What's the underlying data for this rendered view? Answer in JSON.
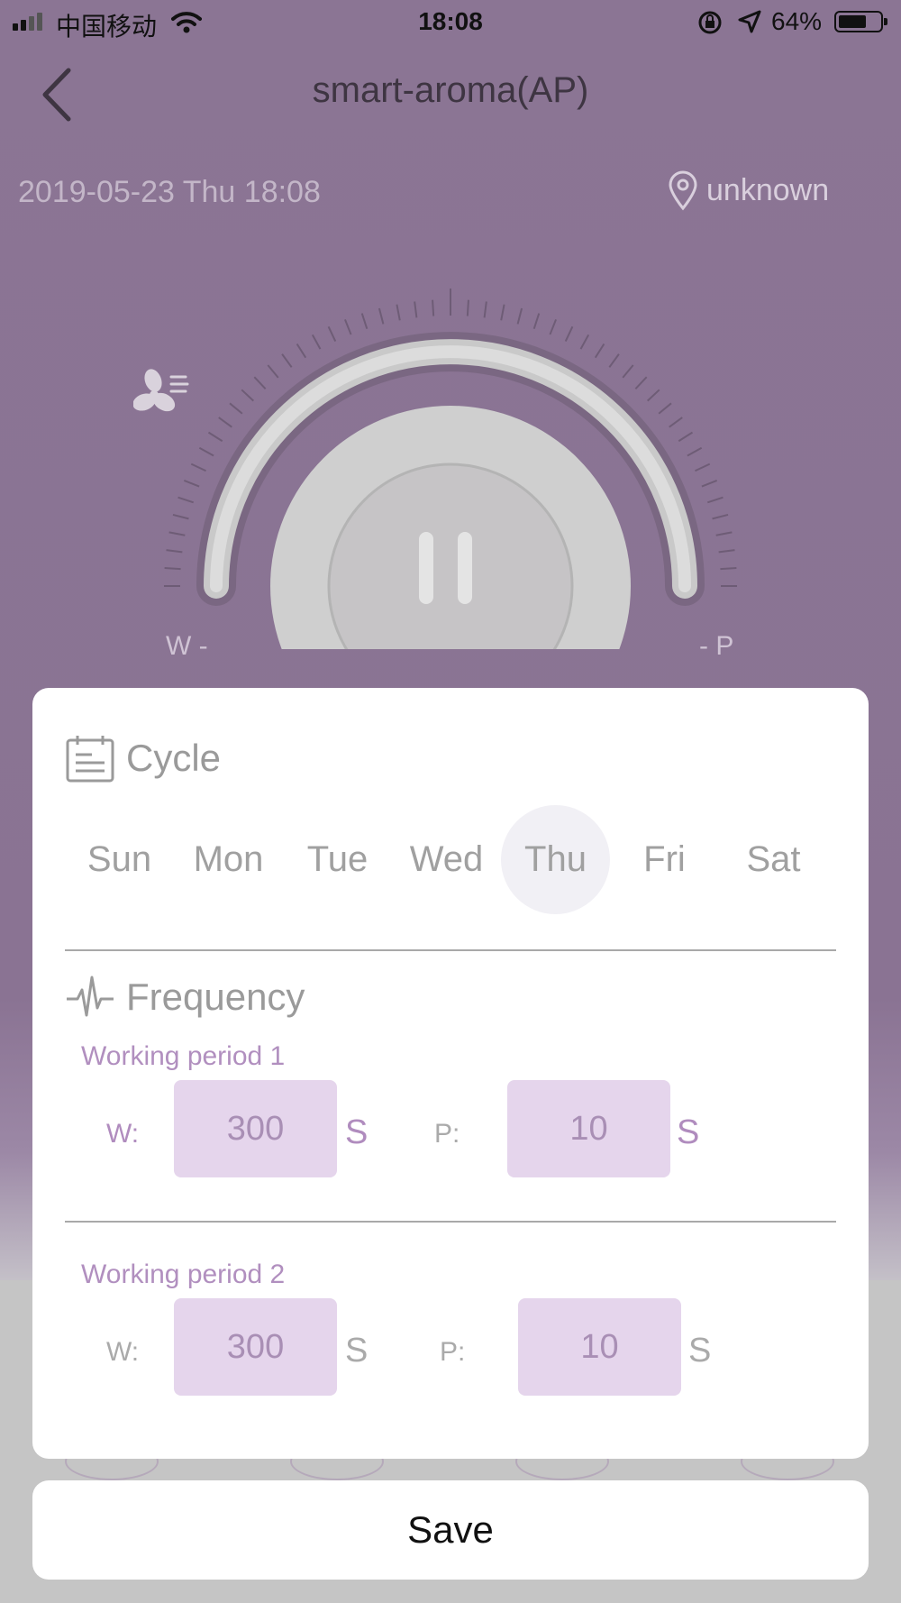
{
  "status_bar": {
    "carrier": "中国移动",
    "time": "18:08",
    "battery": "64%",
    "battery_level": 0.64
  },
  "header": {
    "title": "smart-aroma(AP)",
    "back_icon": "chevron-left-icon"
  },
  "info": {
    "datetime": "2019-05-23 Thu 18:08",
    "location": "unknown",
    "location_icon": "map-pin-icon"
  },
  "dial": {
    "left_label": "W -",
    "right_label": "- P",
    "center_icon": "pause-icon",
    "fan_icon": "fan-icon"
  },
  "modal": {
    "cycle": {
      "title": "Cycle",
      "icon": "calendar-icon",
      "days": [
        "Sun",
        "Mon",
        "Tue",
        "Wed",
        "Thu",
        "Fri",
        "Sat"
      ],
      "selected_day": "Thu"
    },
    "frequency": {
      "title": "Frequency",
      "icon": "pulse-icon",
      "periods": [
        {
          "title": "Working period 1",
          "w_label": "W:",
          "w_value": "300",
          "w_unit": "S",
          "p_label": "P:",
          "p_value": "10",
          "p_unit": "S"
        },
        {
          "title": "Working period 2",
          "w_label": "W:",
          "w_value": "300",
          "w_unit": "S",
          "p_label": "P:",
          "p_value": "10",
          "p_unit": "S"
        }
      ]
    }
  },
  "save_label": "Save",
  "colors": {
    "background": "#8b7594",
    "accent": "#b08cbe",
    "input_fill": "#e5d5ec"
  }
}
